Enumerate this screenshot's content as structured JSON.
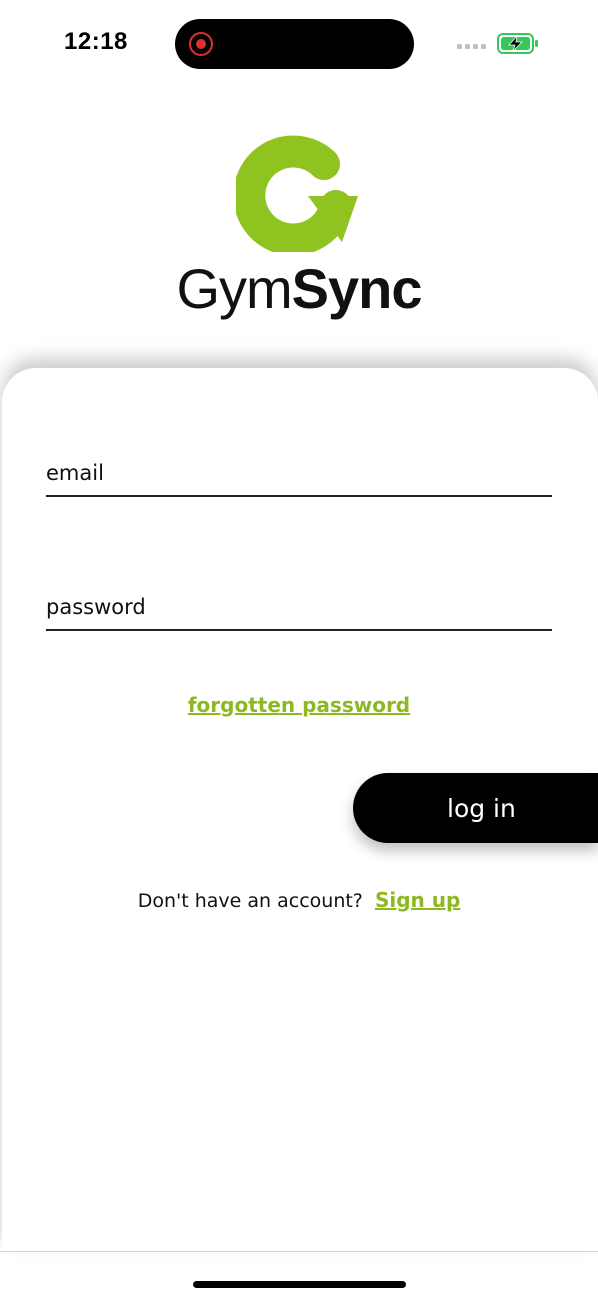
{
  "status_bar": {
    "time": "12:18",
    "recording_indicator_color": "#e0312c",
    "battery_color": "#34c759",
    "icons": [
      "recording-icon",
      "signal-icon",
      "battery-charging-icon"
    ]
  },
  "brand": {
    "name_light": "Gym",
    "name_bold": "Sync",
    "logo_color": "#8fc31f",
    "logo_icon": "gymsync-logo-icon"
  },
  "form": {
    "email_placeholder": "email",
    "password_placeholder": "password",
    "forgot_label": "forgotten password",
    "login_label": "log in",
    "signup_prompt": "Don't have an account?",
    "signup_link": "Sign up"
  },
  "colors": {
    "accent": "#8db81f",
    "button": "#000000",
    "background": "#ffffff"
  }
}
